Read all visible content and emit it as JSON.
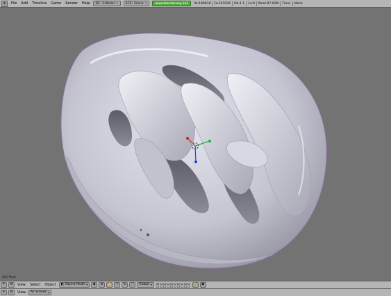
{
  "top_header": {
    "window_icon": "▾",
    "menus": [
      "File",
      "Add",
      "Timeline",
      "Game",
      "Render",
      "Help"
    ],
    "screen_field": {
      "prefix": "SR:",
      "value": "2-Model"
    },
    "scene_field": {
      "prefix": "SCE:",
      "value": "Scene"
    },
    "website": "www.blender.org 242",
    "stats": [
      "Ve:189818",
      "Fa:203036",
      "Ob:1-1",
      "La:0",
      "Mem:97.02M",
      "Time:",
      "Mesh"
    ]
  },
  "viewport": {
    "bg_color": "#737373",
    "view_label": "(28) Mesh"
  },
  "view_header": {
    "menus": [
      "View",
      "Select",
      "Object"
    ],
    "mode": "Object Mode",
    "orientation": "Global"
  },
  "outliner_header": {
    "menus": [
      "View"
    ],
    "filter": "All Scenes"
  },
  "colors": {
    "header_bg": "#b5b5b5",
    "url_badge": "#51b13e",
    "helmet": "#c9c9d6",
    "axis_x": "#d02020",
    "axis_y": "#20b040",
    "axis_z": "#2040d0"
  }
}
